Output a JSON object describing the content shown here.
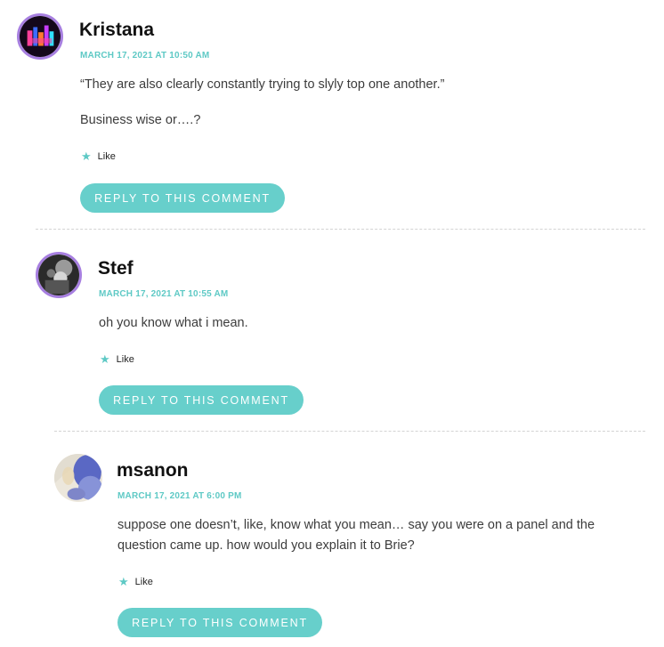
{
  "comments": [
    {
      "author": "Kristana",
      "date": "MARCH 17, 2021 AT 10:50 AM",
      "paragraphs": [
        "“They are also clearly constantly trying to slyly top one another.”",
        "Business wise or….?"
      ],
      "like_label": "Like",
      "reply_label": "REPLY TO THIS COMMENT",
      "avatar_icon": "avatar-neon-icon",
      "avatar_ring_color": "#a77fe0"
    },
    {
      "author": "Stef",
      "date": "MARCH 17, 2021 AT 10:55 AM",
      "paragraphs": [
        "oh you know what i mean."
      ],
      "like_label": "Like",
      "reply_label": "REPLY TO THIS COMMENT",
      "avatar_icon": "avatar-photo-icon",
      "avatar_ring_color": "#a77fe0"
    },
    {
      "author": "msanon",
      "date": "MARCH 17, 2021 AT 6:00 PM",
      "paragraphs": [
        "suppose one doesn’t, like, know what you mean… say you were on a panel and the question came up. how would you explain it to Brie?"
      ],
      "like_label": "Like",
      "reply_label": "REPLY TO THIS COMMENT",
      "avatar_icon": "avatar-abstract-icon"
    }
  ],
  "colors": {
    "accent": "#5ec9c5",
    "button": "#67cfcb",
    "avatar_ring": "#a77fe0",
    "author": "#111111",
    "body_text": "#3c3c3c"
  }
}
